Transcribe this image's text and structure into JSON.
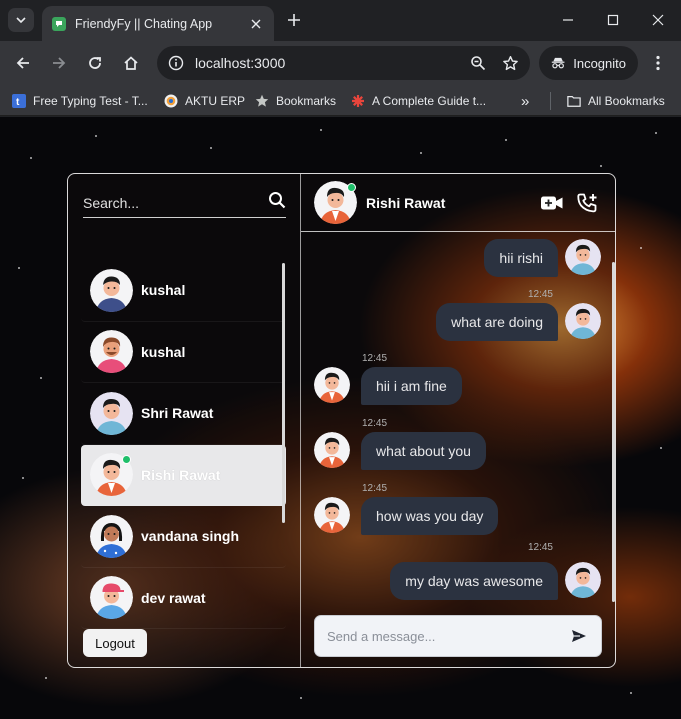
{
  "browser": {
    "tab_title": "FriendyFy || Chating App",
    "url": "localhost:3000",
    "incognito_label": "Incognito",
    "bookmarks": [
      {
        "label": "Free Typing Test - T...",
        "icon": "typing-test-favicon"
      },
      {
        "label": "AKTU ERP",
        "icon": "aktu-favicon"
      },
      {
        "label": "Bookmarks",
        "icon": "star-icon"
      },
      {
        "label": "A Complete Guide t...",
        "icon": "guide-favicon"
      }
    ],
    "more_label": "»",
    "all_bookmarks_label": "All Bookmarks"
  },
  "sidebar": {
    "search_placeholder": "Search...",
    "contacts": [
      {
        "name": "kushal",
        "active": false,
        "online": false
      },
      {
        "name": "kushal",
        "active": false,
        "online": false
      },
      {
        "name": "Shri Rawat",
        "active": false,
        "online": false
      },
      {
        "name": "Rishi Rawat",
        "active": true,
        "online": true
      },
      {
        "name": "vandana singh",
        "active": false,
        "online": false
      },
      {
        "name": "dev rawat",
        "active": false,
        "online": false
      }
    ],
    "logout_label": "Logout"
  },
  "chat": {
    "contact_name": "Rishi Rawat",
    "contact_online": true,
    "messages": [
      {
        "text": "hii rishi",
        "direction": "sent",
        "time": ""
      },
      {
        "text": "what are doing",
        "direction": "sent",
        "time": "12:45"
      },
      {
        "text": "hii i am fine",
        "direction": "received",
        "time": "12:45"
      },
      {
        "text": "what about you",
        "direction": "received",
        "time": "12:45"
      },
      {
        "text": "how was you day",
        "direction": "received",
        "time": "12:45"
      },
      {
        "text": "my day was awesome",
        "direction": "sent",
        "time": "12:45"
      }
    ],
    "composer_placeholder": "Send a message..."
  },
  "colors": {
    "bubble": "#2b3240",
    "online": "#1fbf6a",
    "active_contact": "#e8e8ea"
  }
}
